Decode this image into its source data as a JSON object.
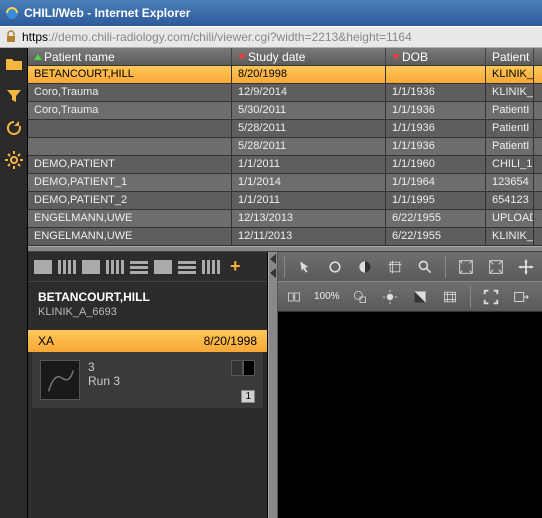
{
  "window": {
    "title": "CHILI/Web - Internet Explorer"
  },
  "url": {
    "scheme": "https",
    "rest": "://demo.chili-radiology.com/chili/viewer.cgi?width=2213&height=1164"
  },
  "patient_table": {
    "columns": {
      "name": "Patient name",
      "study_date": "Study date",
      "dob": "DOB",
      "patient": "Patient"
    },
    "rows": [
      {
        "name": "BETANCOURT,HILL",
        "study_date": "8/20/1998",
        "dob": "",
        "patient": "KLINIK_",
        "sel": true
      },
      {
        "name": "Coro,Trauma",
        "study_date": "12/9/2014",
        "dob": "1/1/1936",
        "patient": "KLINIK_"
      },
      {
        "name": "Coro,Trauma",
        "study_date": "5/30/2011",
        "dob": "1/1/1936",
        "patient": "PatientI"
      },
      {
        "name": "",
        "study_date": "5/28/2011",
        "dob": "1/1/1936",
        "patient": "PatientI"
      },
      {
        "name": "",
        "study_date": "5/28/2011",
        "dob": "1/1/1936",
        "patient": "PatientI"
      },
      {
        "name": "DEMO,PATIENT",
        "study_date": "1/1/2011",
        "dob": "1/1/1960",
        "patient": "CHILI_1"
      },
      {
        "name": "DEMO,PATIENT_1",
        "study_date": "1/1/2014",
        "dob": "1/1/1964",
        "patient": "123654"
      },
      {
        "name": "DEMO,PATIENT_2",
        "study_date": "1/1/2011",
        "dob": "1/1/1995",
        "patient": "654123"
      },
      {
        "name": "ENGELMANN,UWE",
        "study_date": "12/13/2013",
        "dob": "6/22/1955",
        "patient": "UPLOAD"
      },
      {
        "name": "ENGELMANN,UWE",
        "study_date": "12/11/2013",
        "dob": "6/22/1955",
        "patient": "KLINIK_"
      }
    ]
  },
  "series_panel": {
    "patient_name": "BETANCOURT,HILL",
    "patient_id": "KLINIK_A_6693",
    "series_header": {
      "modality": "XA",
      "date": "8/20/1998"
    },
    "thumb": {
      "number": "3",
      "desc": "Run 3",
      "count": "1"
    }
  },
  "viewer_toolbar2": {
    "zoom": "100%"
  }
}
